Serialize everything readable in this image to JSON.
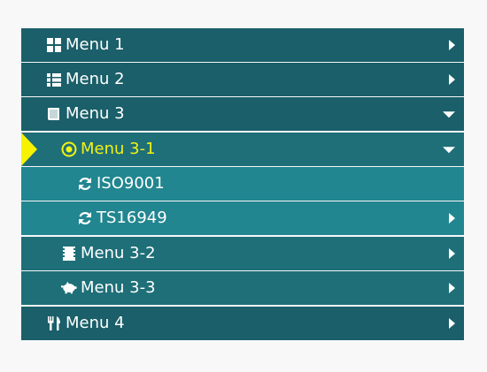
{
  "menu": {
    "items": [
      {
        "label": "Menu 1",
        "icon": "th-large-icon",
        "expanded": false
      },
      {
        "label": "Menu 2",
        "icon": "list-icon",
        "expanded": false
      },
      {
        "label": "Menu 3",
        "icon": "book-icon",
        "expanded": true,
        "children": [
          {
            "label": "Menu 3-1",
            "icon": "target-icon",
            "expanded": true,
            "active": true,
            "children": [
              {
                "label": "ISO9001",
                "icon": "refresh-icon"
              },
              {
                "label": "TS16949",
                "icon": "refresh-icon",
                "has_children": true
              }
            ]
          },
          {
            "label": "Menu 3-2",
            "icon": "film-icon",
            "expanded": false
          },
          {
            "label": "Menu 3-3",
            "icon": "piggy-bank-icon",
            "expanded": false
          }
        ]
      },
      {
        "label": "Menu 4",
        "icon": "cutlery-icon",
        "expanded": false
      }
    ]
  },
  "colors": {
    "level1_bg": "#1a5f69",
    "level2_bg": "#1e6f78",
    "level3_bg": "#218690",
    "active_text": "#f2f212",
    "active_marker": "#f7f300",
    "text": "#ffffff",
    "page_bg": "#f8f8f8"
  }
}
